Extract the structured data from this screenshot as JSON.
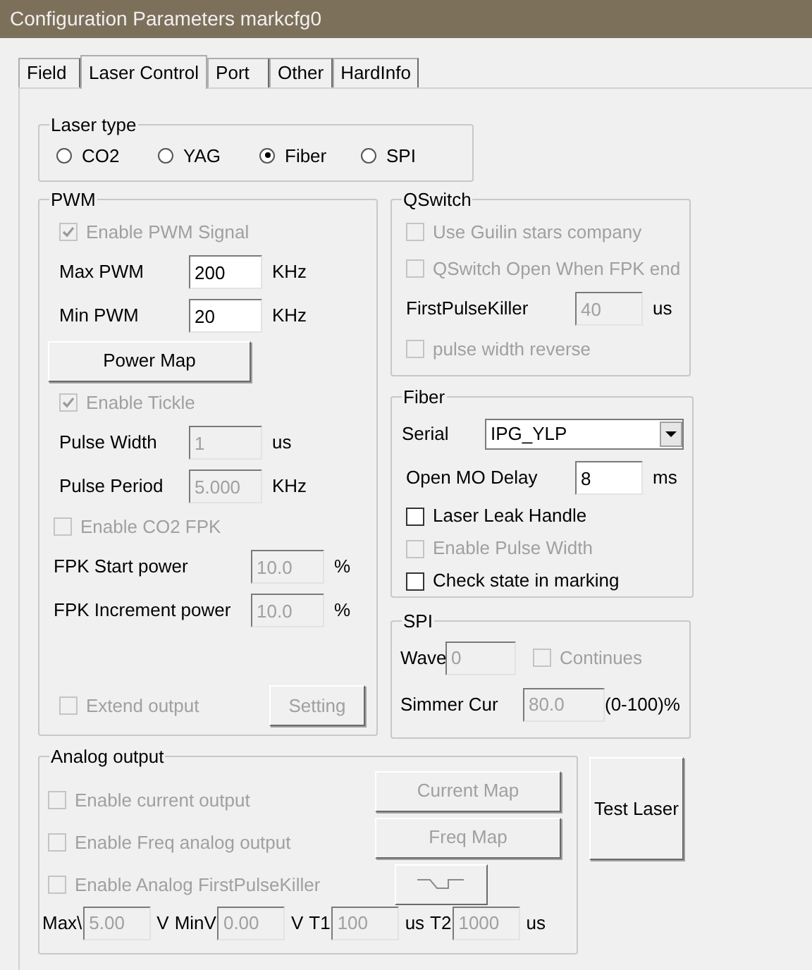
{
  "window": {
    "title": "Configuration Parameters markcfg0"
  },
  "tabs": [
    {
      "label": "Field",
      "selected": false
    },
    {
      "label": "Laser Control",
      "selected": true
    },
    {
      "label": "Port",
      "selected": false
    },
    {
      "label": "Other",
      "selected": false
    },
    {
      "label": "HardInfo",
      "selected": false
    }
  ],
  "laser_type": {
    "title": "Laser type",
    "options": [
      {
        "label": "CO2",
        "selected": false
      },
      {
        "label": "YAG",
        "selected": false
      },
      {
        "label": "Fiber",
        "selected": true
      },
      {
        "label": "SPI",
        "selected": false
      }
    ]
  },
  "pwm": {
    "title": "PWM",
    "main": [
      {
        "kind": "checkbox",
        "label": "Enable PWM Signal",
        "checked": true,
        "disabled": true
      },
      {
        "kind": "field",
        "label": "Max PWM",
        "value": "200",
        "unit": "KHz",
        "disabled": false
      },
      {
        "kind": "field",
        "label": "Min PWM",
        "value": "20",
        "unit": "KHz",
        "disabled": false
      },
      {
        "kind": "button",
        "label": "Power Map",
        "disabled": false
      },
      {
        "kind": "checkbox",
        "label": "Enable Tickle",
        "checked": true,
        "disabled": true
      },
      {
        "kind": "field",
        "label": "Pulse Width",
        "value": "1",
        "unit": "us",
        "disabled": true
      },
      {
        "kind": "field",
        "label": "Pulse Period",
        "value": "5.000",
        "unit": "KHz",
        "disabled": true
      }
    ],
    "fpk": [
      {
        "kind": "checkbox",
        "label": "Enable CO2 FPK",
        "checked": false,
        "disabled": true
      },
      {
        "kind": "field",
        "label": "FPK Start power",
        "value": "10.0",
        "unit": "%",
        "disabled": true
      },
      {
        "kind": "field",
        "label": "FPK Increment power",
        "value": "10.0",
        "unit": "%",
        "disabled": true
      }
    ],
    "footer": {
      "checkbox": {
        "label": "Extend output",
        "checked": false,
        "disabled": true
      },
      "button": {
        "label": "Setting",
        "disabled": true
      }
    }
  },
  "qswitch": {
    "title": "QSwitch",
    "items": [
      {
        "kind": "checkbox",
        "label": "Use Guilin stars company",
        "checked": false,
        "disabled": true
      },
      {
        "kind": "checkbox",
        "label": "QSwitch Open When FPK end",
        "checked": false,
        "disabled": true
      },
      {
        "kind": "field",
        "label": "FirstPulseKiller",
        "value": "40",
        "unit": "us",
        "disabled": true
      },
      {
        "kind": "checkbox",
        "label": "pulse width reverse",
        "checked": false,
        "disabled": true
      }
    ]
  },
  "fiber": {
    "title": "Fiber",
    "items": [
      {
        "kind": "select",
        "label": "Serial",
        "value": "IPG_YLP"
      },
      {
        "kind": "field",
        "label": "Open MO Delay",
        "value": "8",
        "unit": "ms",
        "disabled": false
      },
      {
        "kind": "checkbox",
        "label": "Laser Leak Handle",
        "checked": false,
        "disabled": false
      },
      {
        "kind": "checkbox",
        "label": "Enable Pulse Width",
        "checked": false,
        "disabled": true
      },
      {
        "kind": "checkbox",
        "label": "Check state in marking",
        "checked": false,
        "disabled": false
      }
    ]
  },
  "spi": {
    "title": "SPI",
    "wave": {
      "label": "Wave",
      "value": "0",
      "disabled": true
    },
    "continues": {
      "label": "Continues",
      "checked": false,
      "disabled": true
    },
    "simmer": {
      "label": "Simmer Cur",
      "value": "80.0",
      "unit": "(0-100)%",
      "disabled": true
    }
  },
  "analog": {
    "title": "Analog output",
    "checkboxes": [
      {
        "label": "Enable current output",
        "checked": false,
        "disabled": true
      },
      {
        "label": "Enable Freq analog output",
        "checked": false,
        "disabled": true
      },
      {
        "label": "Enable Analog FirstPulseKiller",
        "checked": false,
        "disabled": true
      }
    ],
    "buttons": [
      {
        "kind": "text",
        "label": "Current Map",
        "disabled": true
      },
      {
        "kind": "text",
        "label": "Freq Map",
        "disabled": true
      },
      {
        "kind": "wave",
        "disabled": true
      }
    ],
    "fields": [
      {
        "label": "Max\\",
        "value": "5.00",
        "unit": "V",
        "disabled": true
      },
      {
        "label": "MinV",
        "value": "0.00",
        "unit": "V",
        "disabled": true
      },
      {
        "label": "T1",
        "value": "100",
        "unit": "us",
        "disabled": true
      },
      {
        "label": "T2",
        "value": "1000",
        "unit": "us",
        "disabled": true
      }
    ]
  },
  "test_button": {
    "label": "Test Laser"
  }
}
